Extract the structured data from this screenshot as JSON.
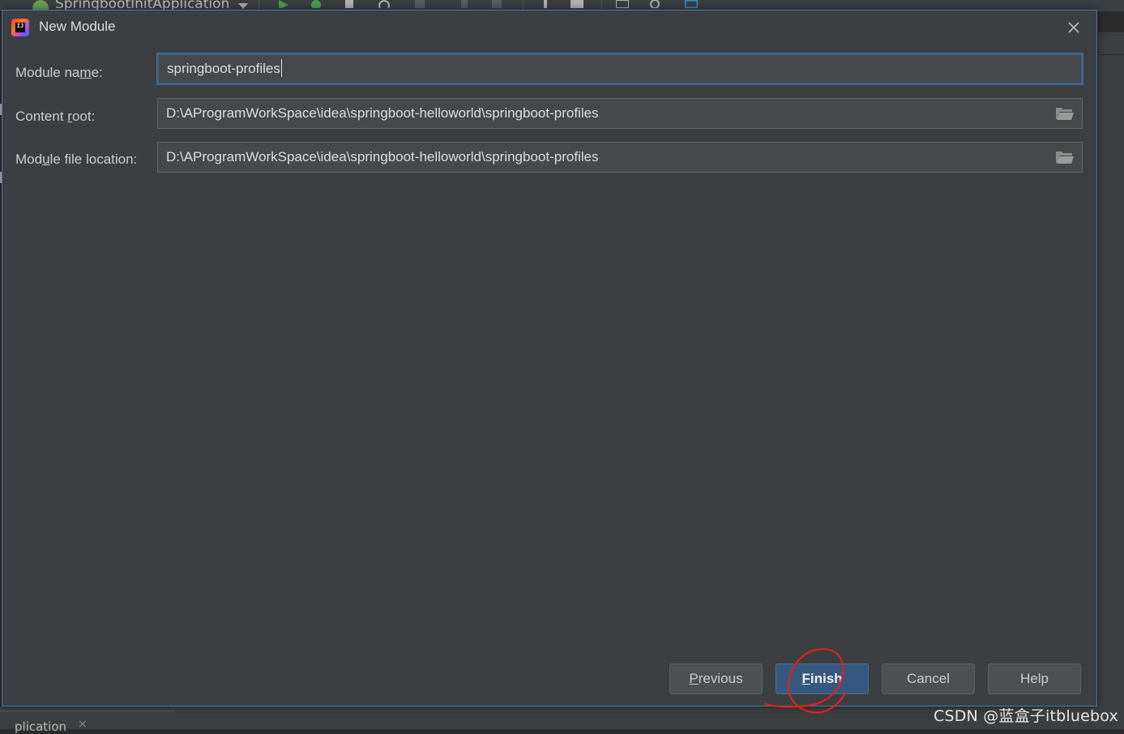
{
  "ide": {
    "run_config_name": "SpringbootInitApplication",
    "bottom_tab_label": "plication"
  },
  "dialog": {
    "title": "New Module",
    "fields": {
      "module_name": {
        "label_pre": "Module na",
        "label_mnemonic": "m",
        "label_post": "e:",
        "value": "springboot-profiles"
      },
      "content_root": {
        "label_pre": "Content ",
        "label_mnemonic": "r",
        "label_post": "oot:",
        "value": "D:\\AProgramWorkSpace\\idea\\springboot-helloworld\\springboot-profiles"
      },
      "module_file_location": {
        "label_pre": "Mod",
        "label_mnemonic": "u",
        "label_post": "le file location:",
        "value": "D:\\AProgramWorkSpace\\idea\\springboot-helloworld\\springboot-profiles"
      }
    },
    "buttons": {
      "previous": {
        "mnemonic": "P",
        "rest": "revious"
      },
      "finish": {
        "mnemonic": "F",
        "rest": "inish"
      },
      "cancel": "Cancel",
      "help": "Help"
    }
  },
  "colors": {
    "dialog_bg": "#3c3f41",
    "field_bg": "#45494a",
    "focus_border": "#3d6185",
    "primary_button": "#365880",
    "annotation": "#e0201c"
  },
  "icons": [
    "intellij-idea-icon",
    "close-icon",
    "folder-icon",
    "run-icon",
    "debug-icon"
  ],
  "watermark": "CSDN @蓝盒子itbluebox"
}
